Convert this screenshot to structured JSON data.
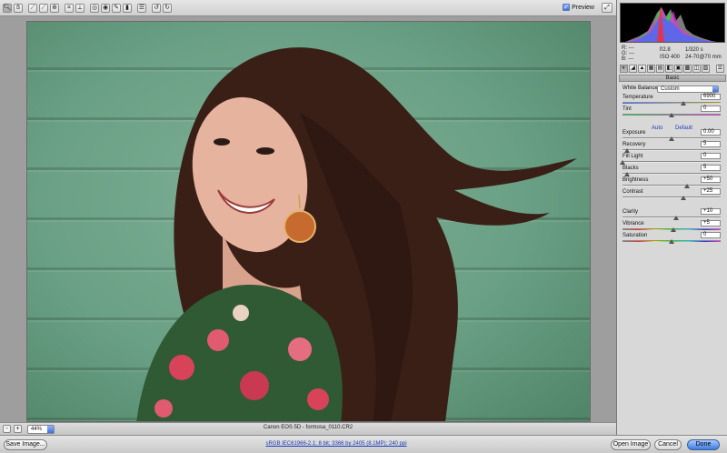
{
  "toolbar": {
    "tools": [
      {
        "name": "zoom-tool",
        "glyph": "🔍︎"
      },
      {
        "name": "hand-tool",
        "glyph": "✋︎"
      },
      {
        "name": "white-balance-tool",
        "glyph": "⟋"
      },
      {
        "name": "color-sampler-tool",
        "glyph": "⟋"
      },
      {
        "name": "targeted-adjustment-tool",
        "glyph": "⊕"
      },
      {
        "name": "crop-tool",
        "glyph": "⌗"
      },
      {
        "name": "straighten-tool",
        "glyph": "⟂"
      },
      {
        "name": "spot-removal-tool",
        "glyph": "◎"
      },
      {
        "name": "red-eye-tool",
        "glyph": "◉"
      },
      {
        "name": "adjustment-brush-tool",
        "glyph": "✎"
      },
      {
        "name": "graduated-filter-tool",
        "glyph": "▮"
      },
      {
        "name": "preferences-tool",
        "glyph": "☰"
      },
      {
        "name": "rotate-left-tool",
        "glyph": "↺"
      },
      {
        "name": "rotate-right-tool",
        "glyph": "↻"
      }
    ],
    "preview_label": "Preview",
    "preview_checked": "✓"
  },
  "status": {
    "zoom_out": "-",
    "zoom_in": "+",
    "zoom": "44%",
    "camera_file": "Canon EOS 5D  -  formosa_0110.CR2"
  },
  "bottom": {
    "save_image": "Save Image...",
    "workflow": "sRGB IEC61966-2.1; 8 bit; 3366 by 2405 (8.1MP); 240 ppi",
    "open_image": "Open Image",
    "cancel": "Cancel",
    "done": "Done"
  },
  "readout": {
    "r_label": "R:",
    "g_label": "G:",
    "b_label": "B:",
    "r_val": "---",
    "g_val": "---",
    "b_val": "---",
    "aperture": "f/2.8",
    "shutter": "1/320 s",
    "iso": "ISO 400",
    "lens": "24-70@70 mm"
  },
  "panel": {
    "section_title": "Basic",
    "white_balance_label": "White Balance:",
    "white_balance_value": "Custom",
    "auto": "Auto",
    "default": "Default",
    "controls": [
      {
        "key": "temperature",
        "label": "Temperature",
        "value": "6900",
        "pos": 0.62
      },
      {
        "key": "tint",
        "label": "Tint",
        "value": "0",
        "pos": 0.5
      },
      {
        "key": "exposure",
        "label": "Exposure",
        "value": "0.00",
        "pos": 0.5
      },
      {
        "key": "recovery",
        "label": "Recovery",
        "value": "5",
        "pos": 0.05
      },
      {
        "key": "fill-light",
        "label": "Fill Light",
        "value": "0",
        "pos": 0.0
      },
      {
        "key": "blacks",
        "label": "Blacks",
        "value": "5",
        "pos": 0.05
      },
      {
        "key": "brightness",
        "label": "Brightness",
        "value": "+50",
        "pos": 0.66
      },
      {
        "key": "contrast",
        "label": "Contrast",
        "value": "+25",
        "pos": 0.62
      },
      {
        "key": "clarity",
        "label": "Clarity",
        "value": "+10",
        "pos": 0.55
      },
      {
        "key": "vibrance",
        "label": "Vibrance",
        "value": "+5",
        "pos": 0.52
      },
      {
        "key": "saturation",
        "label": "Saturation",
        "value": "0",
        "pos": 0.5
      }
    ]
  },
  "panel_tabs": [
    "◐",
    "◢",
    "▲",
    "▦",
    "▤",
    "◧",
    "▣",
    "▩",
    "◫",
    "▧",
    "☰"
  ],
  "colors": {
    "photo_bg": "#6aa085",
    "hair": "#3a1f17",
    "skin": "#e6b39f",
    "accent": "#3d7be0"
  }
}
